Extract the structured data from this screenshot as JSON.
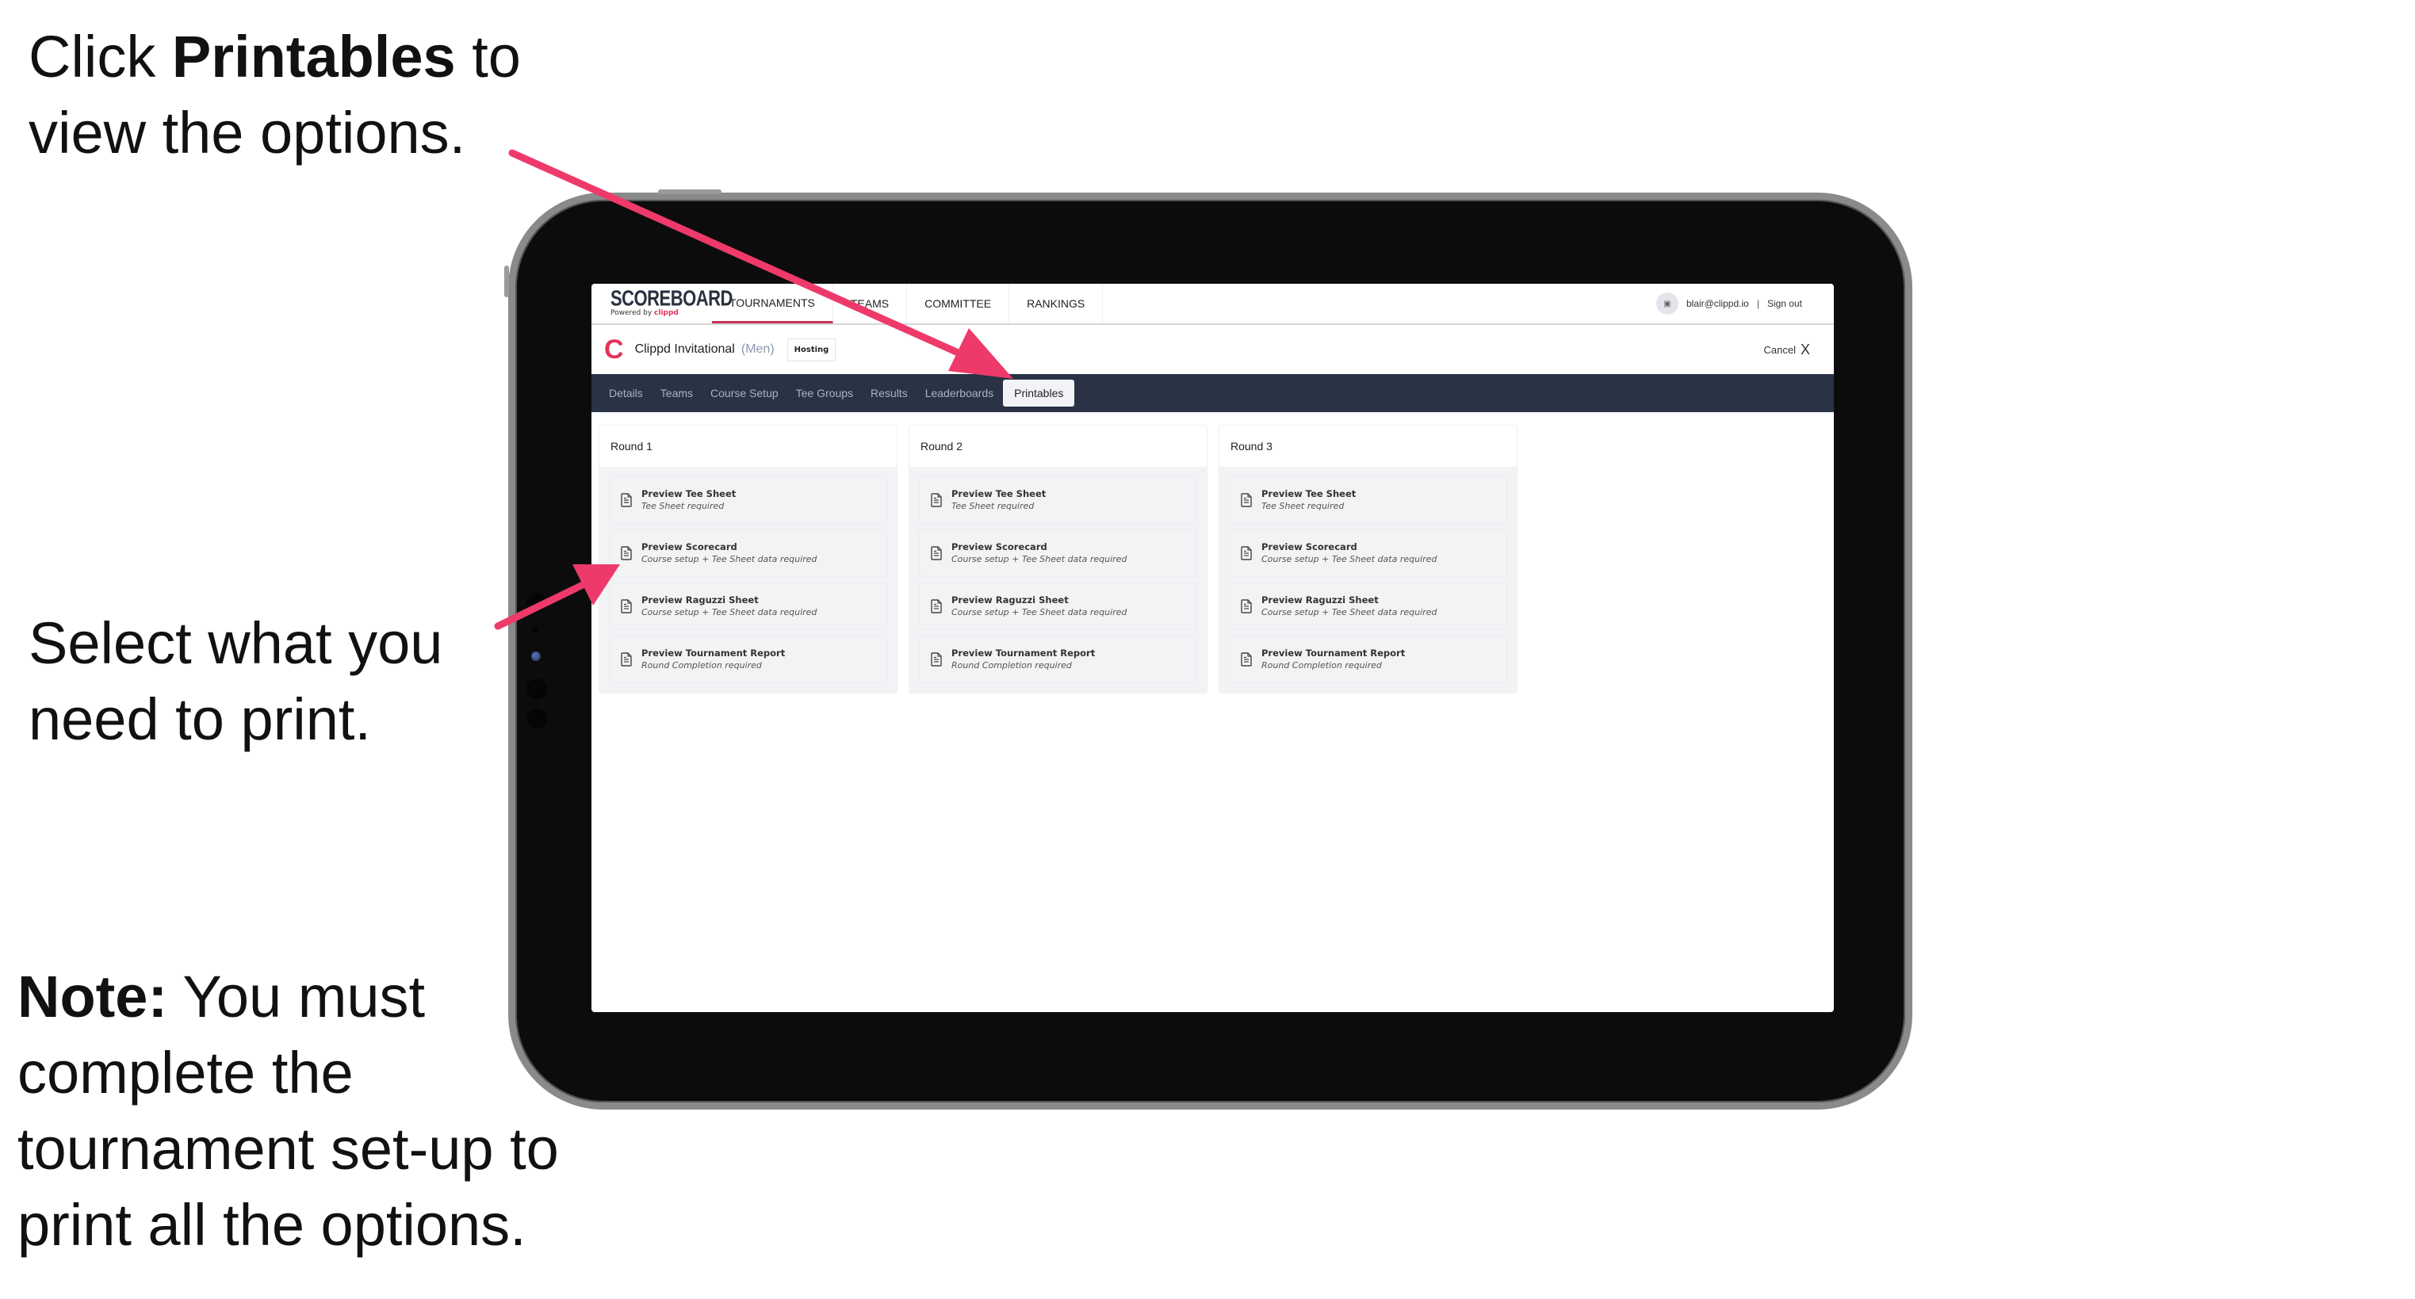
{
  "annotations": {
    "top": {
      "prefix": "Click ",
      "bold": "Printables",
      "suffix": " to view the options."
    },
    "middle": {
      "text": "Select what you need to print."
    },
    "note": {
      "bold": "Note:",
      "text": " You must complete the tournament set-up to print all the options."
    },
    "arrow_color": "#ee3a6b"
  },
  "app": {
    "logo": {
      "title": "SCOREBOARD",
      "powered_by": "Powered by ",
      "brand": "clippd"
    },
    "top_nav": [
      {
        "label": "TOURNAMENTS",
        "active": true
      },
      {
        "label": "TEAMS",
        "active": false
      },
      {
        "label": "COMMITTEE",
        "active": false
      },
      {
        "label": "RANKINGS",
        "active": false
      }
    ],
    "user": {
      "avatar_icon": "image-icon",
      "email": "blair@clippd.io",
      "separator": "|",
      "sign_out": "Sign out"
    },
    "tournament": {
      "logo_letter": "C",
      "name": "Clippd Invitational",
      "gender": "(Men)",
      "badge": "Hosting",
      "cancel_label": "Cancel",
      "cancel_icon": "X"
    },
    "tabs": [
      {
        "label": "Details",
        "active": false
      },
      {
        "label": "Teams",
        "active": false
      },
      {
        "label": "Course Setup",
        "active": false
      },
      {
        "label": "Tee Groups",
        "active": false
      },
      {
        "label": "Results",
        "active": false
      },
      {
        "label": "Leaderboards",
        "active": false
      },
      {
        "label": "Printables",
        "active": true
      }
    ],
    "rounds": [
      {
        "title": "Round 1",
        "options": [
          {
            "title": "Preview Tee Sheet",
            "subtitle": "Tee Sheet required"
          },
          {
            "title": "Preview Scorecard",
            "subtitle": "Course setup + Tee Sheet data required"
          },
          {
            "title": "Preview Raguzzi Sheet",
            "subtitle": "Course setup + Tee Sheet data required"
          },
          {
            "title": "Preview Tournament Report",
            "subtitle": "Round Completion required"
          }
        ]
      },
      {
        "title": "Round 2",
        "options": [
          {
            "title": "Preview Tee Sheet",
            "subtitle": "Tee Sheet required"
          },
          {
            "title": "Preview Scorecard",
            "subtitle": "Course setup + Tee Sheet data required"
          },
          {
            "title": "Preview Raguzzi Sheet",
            "subtitle": "Course setup + Tee Sheet data required"
          },
          {
            "title": "Preview Tournament Report",
            "subtitle": "Round Completion required"
          }
        ]
      },
      {
        "title": "Round 3",
        "options": [
          {
            "title": "Preview Tee Sheet",
            "subtitle": "Tee Sheet required"
          },
          {
            "title": "Preview Scorecard",
            "subtitle": "Course setup + Tee Sheet data required"
          },
          {
            "title": "Preview Raguzzi Sheet",
            "subtitle": "Course setup + Tee Sheet data required"
          },
          {
            "title": "Preview Tournament Report",
            "subtitle": "Round Completion required"
          }
        ]
      }
    ]
  }
}
